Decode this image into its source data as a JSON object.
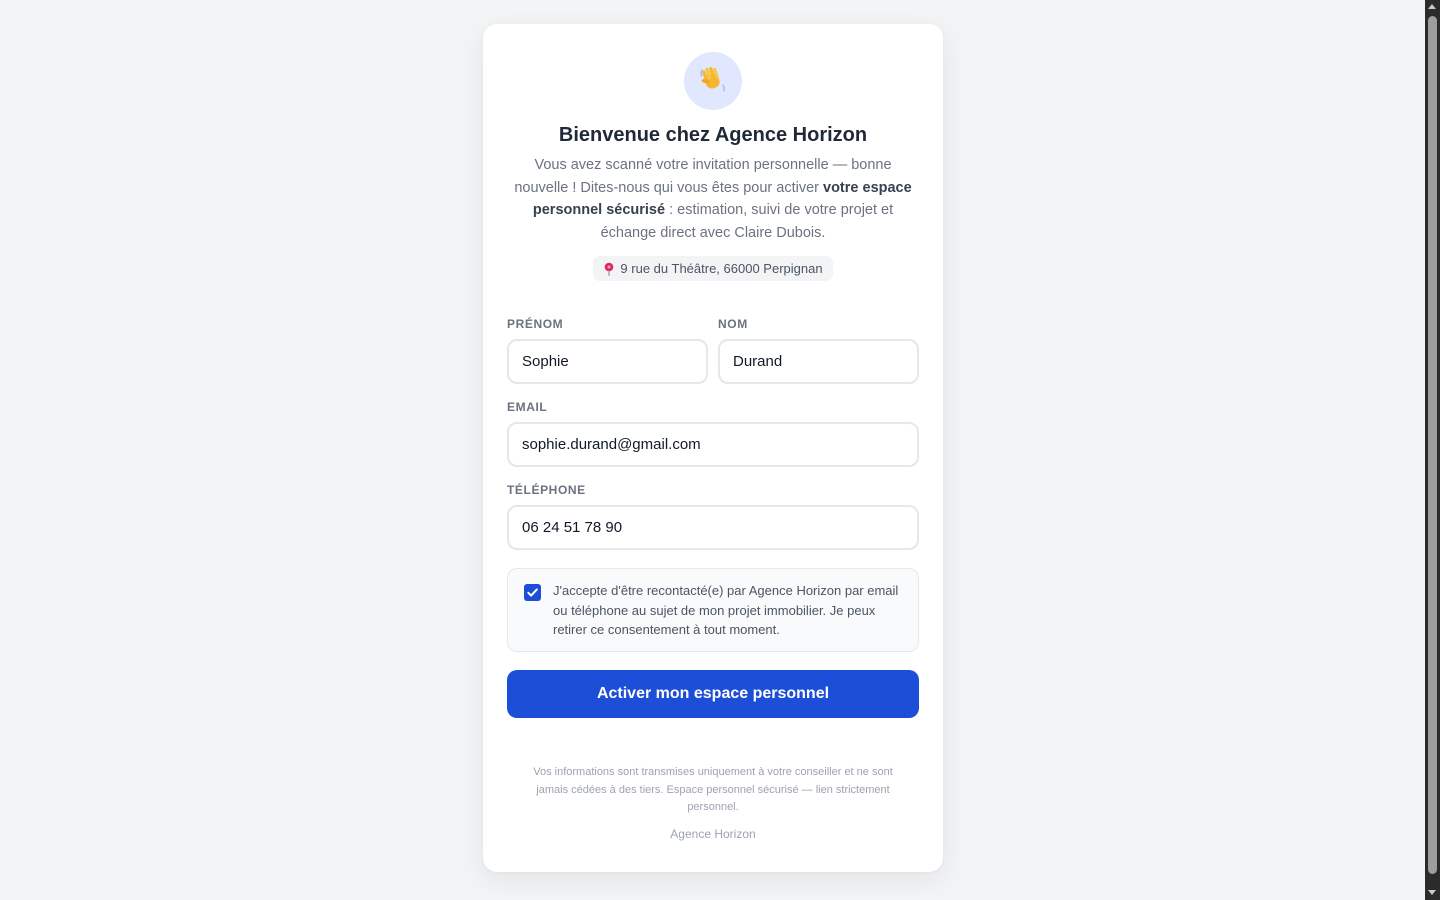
{
  "welcome": {
    "emoji": "👋",
    "title": "Bienvenue chez Agence Horizon",
    "intro_before": "Vous avez scanné votre invitation personnelle — bonne nouvelle ! Dites-nous qui vous êtes pour activer ",
    "intro_bold": "votre espace personnel sécurisé",
    "intro_after": " : estimation, suivi de votre projet et échange direct avec Claire Dubois.",
    "address": "9 rue du Théâtre, 66000 Perpignan"
  },
  "form": {
    "first_name": {
      "label": "Prénom",
      "value": "Sophie"
    },
    "last_name": {
      "label": "Nom",
      "value": "Durand"
    },
    "email": {
      "label": "Email",
      "value": "sophie.durand@gmail.com"
    },
    "phone": {
      "label": "Téléphone",
      "value": "06 24 51 78 90"
    },
    "consent": {
      "checked": true,
      "text": "J'accepte d'être recontacté(e) par Agence Horizon par email ou téléphone au sujet de mon projet immobilier. Je peux retirer ce consentement à tout moment."
    },
    "submit_label": "Activer mon espace personnel"
  },
  "footer": {
    "disclaimer": "Vos informations sont transmises uniquement à votre conseiller et ne sont jamais cédées à des tiers. Espace personnel sécurisé — lien strictement personnel.",
    "brand": "Agence Horizon"
  },
  "colors": {
    "accent": "#1d4ed8",
    "avatar_bg": "#e0e7ff",
    "page_bg": "#f3f4f6"
  }
}
